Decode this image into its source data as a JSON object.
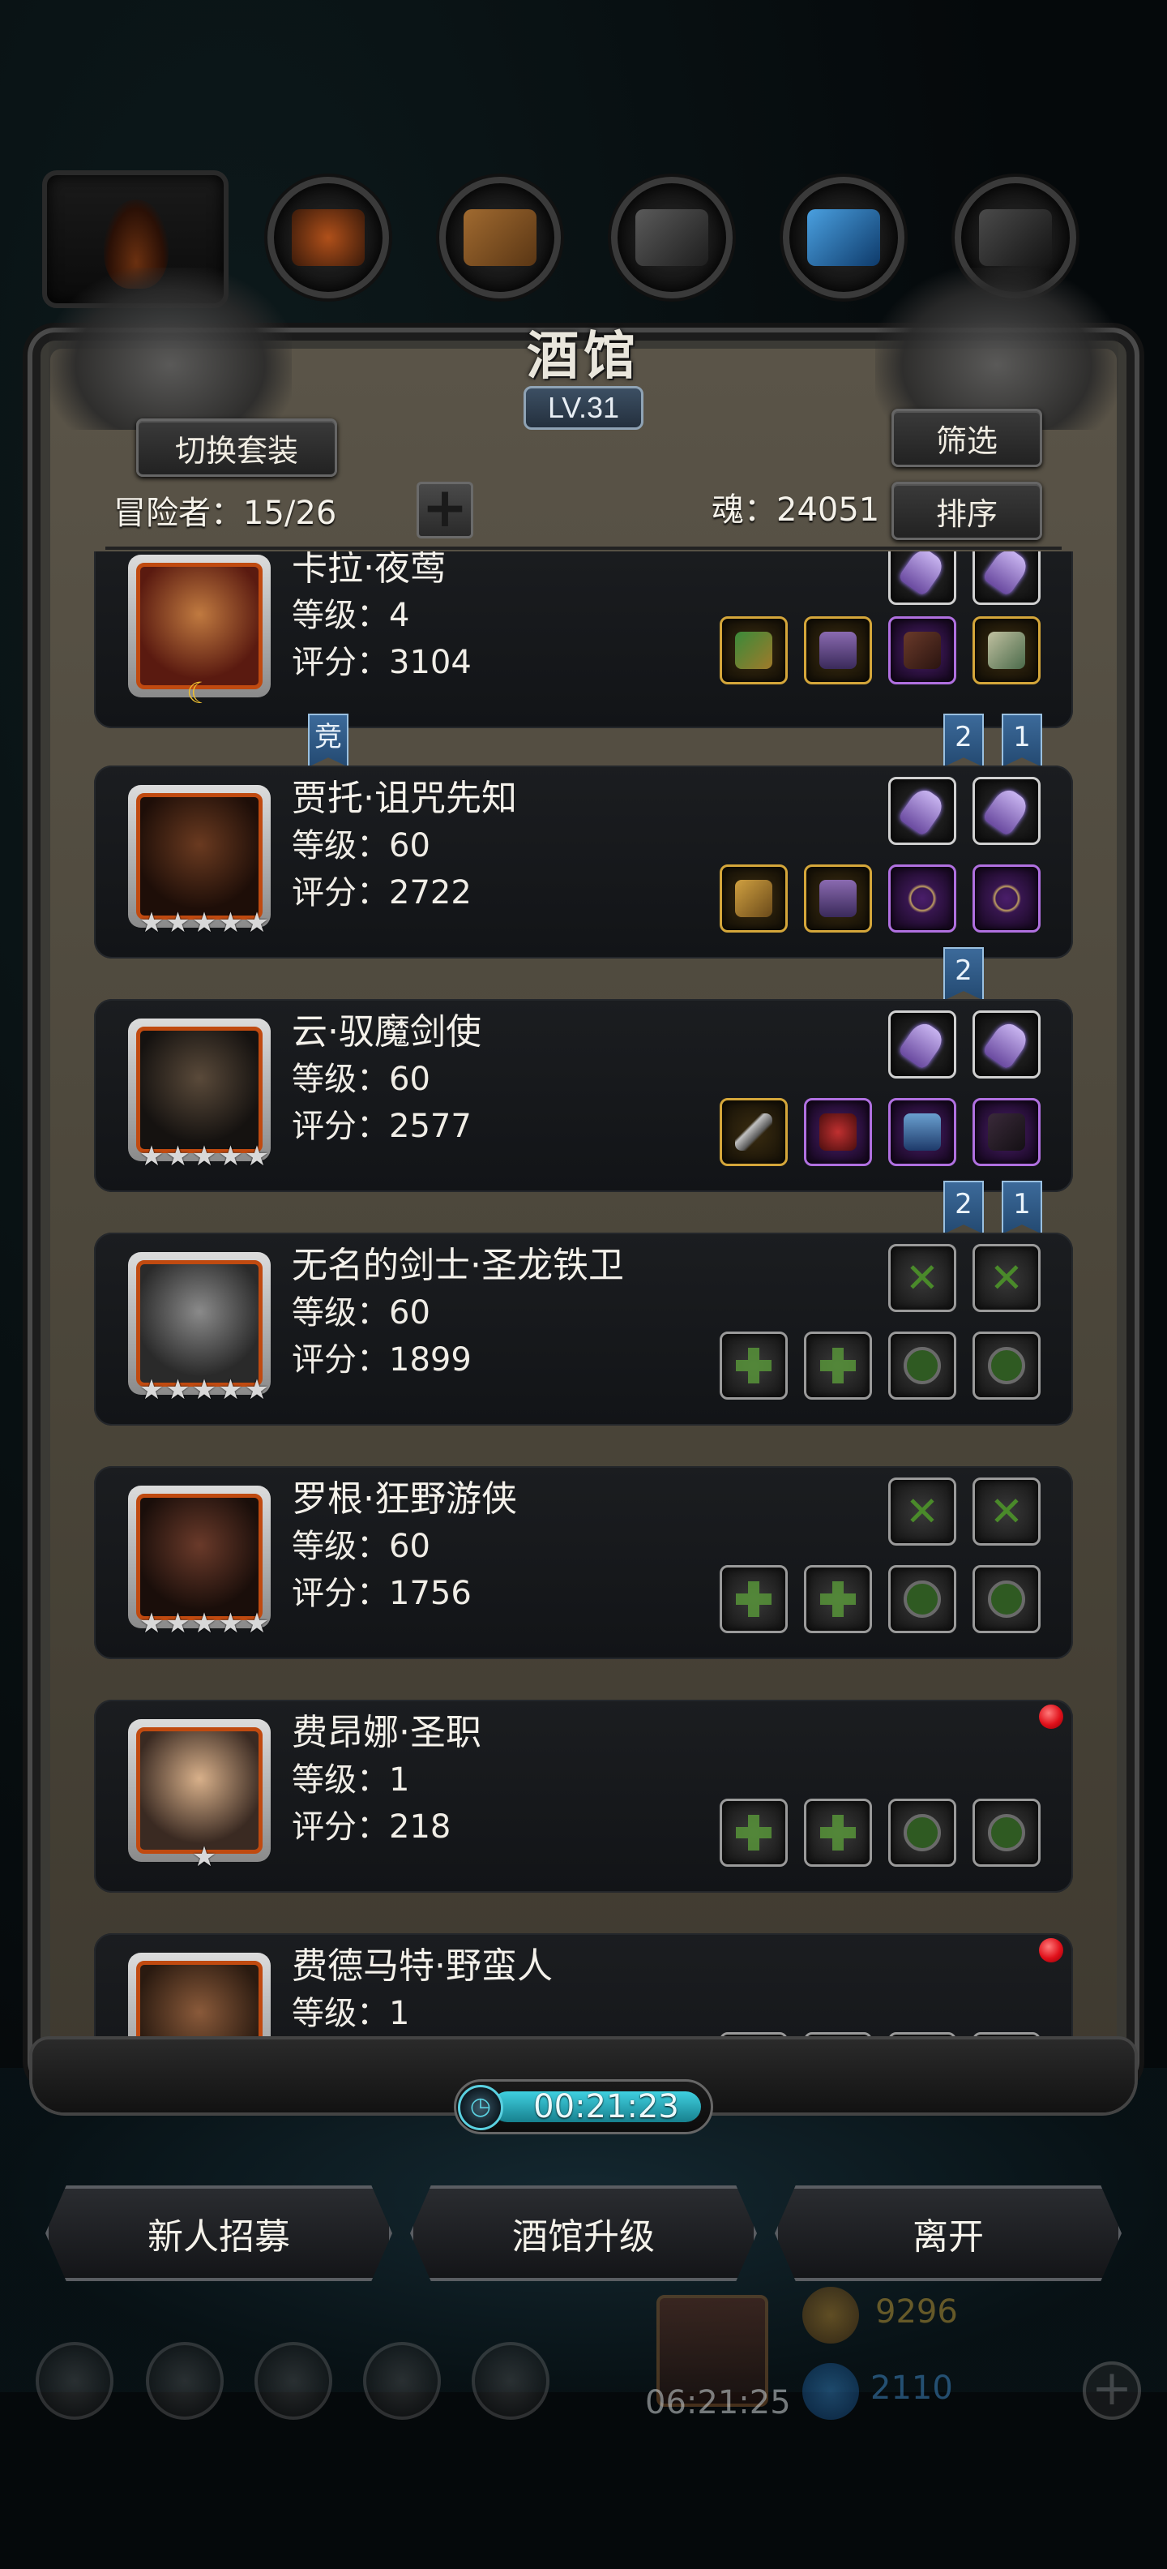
{
  "panel": {
    "title": "酒馆",
    "level": "LV.31",
    "switch_outfit_label": "切换套装",
    "filter_label": "筛选",
    "sort_label": "排序",
    "adventurers_text": "冒险者：15/26",
    "soul_text": "魂：24051",
    "add_label": "+"
  },
  "top_tabs": [
    {
      "icon": "flame-icon"
    },
    {
      "icon": "ore-icon",
      "color": "#7a3a20"
    },
    {
      "icon": "wood-icon",
      "color": "#8a5a2a"
    },
    {
      "icon": "stone-icon",
      "color": "#555555"
    },
    {
      "icon": "crystal-icon",
      "color": "#2a6aa0"
    },
    {
      "icon": "iron-icon",
      "color": "#444444"
    }
  ],
  "heroes": [
    {
      "name": "卡拉·夜莺",
      "level": "等级：4",
      "score": "评分：3104",
      "stars": 0,
      "moon": "☾",
      "c1": "#c07a40",
      "c2": "#5a1a10",
      "tags_below": [
        "竞"
      ],
      "tags_right": [
        "2",
        "1"
      ],
      "red_dot": false
    },
    {
      "name": "贾托·诅咒先知",
      "level": "等级：60",
      "score": "评分：2722",
      "stars": 5,
      "c1": "#6a3a20",
      "c2": "#1e0e08",
      "tags_right": [
        "2"
      ],
      "red_dot": false
    },
    {
      "name": "云·驭魔剑使",
      "level": "等级：60",
      "score": "评分：2577",
      "stars": 5,
      "c1": "#5a4a3a",
      "c2": "#151210",
      "tags_right": [
        "2",
        "1"
      ],
      "red_dot": false
    },
    {
      "name": "无名的剑士·圣龙铁卫",
      "level": "等级：60",
      "score": "评分：1899",
      "stars": 5,
      "c1": "#8a8a8a",
      "c2": "#2a2a2a",
      "red_dot": false
    },
    {
      "name": "罗根·狂野游侠",
      "level": "等级：60",
      "score": "评分：1756",
      "stars": 5,
      "c1": "#6a3a2a",
      "c2": "#1a0e0a",
      "red_dot": false
    },
    {
      "name": "费昂娜·圣职",
      "level": "等级：1",
      "score": "评分：218",
      "stars": 1,
      "c1": "#d8b08a",
      "c2": "#3a2a22",
      "red_dot": true
    },
    {
      "name": "费德马特·野蛮人",
      "level": "等级：1",
      "score": "",
      "stars": 0,
      "c1": "#8a5a3a",
      "c2": "#2a1a10",
      "red_dot": true
    }
  ],
  "timer": "00:21:23",
  "buttons": {
    "recruit": "新人招募",
    "upgrade": "酒馆升级",
    "leave": "离开"
  },
  "hud": {
    "gift_time": "06:21:25",
    "gold": "9296",
    "gems": "2110"
  }
}
